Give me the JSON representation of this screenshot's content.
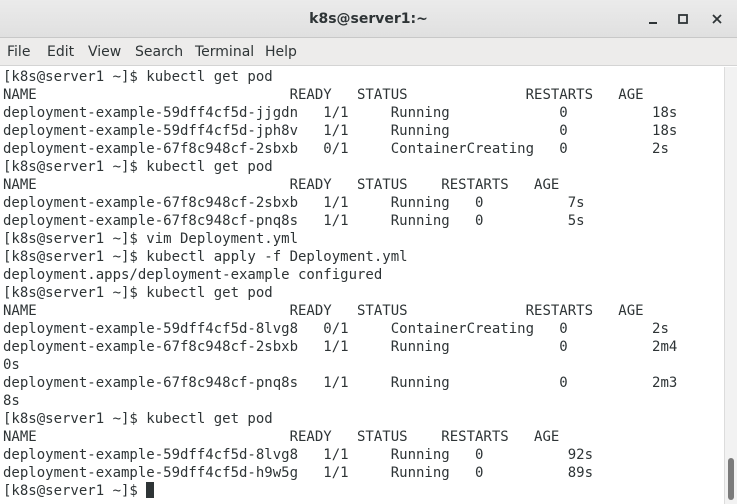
{
  "window": {
    "title": "k8s@server1:~"
  },
  "menubar": {
    "items": [
      "File",
      "Edit",
      "View",
      "Search",
      "Terminal",
      "Help"
    ]
  },
  "terminal": {
    "lines": [
      "[k8s@server1 ~]$ kubectl get pod",
      "NAME                              READY   STATUS              RESTARTS   AGE",
      "deployment-example-59dff4cf5d-jjgdn   1/1     Running             0          18s",
      "deployment-example-59dff4cf5d-jph8v   1/1     Running             0          18s",
      "deployment-example-67f8c948cf-2sbxb   0/1     ContainerCreating   0          2s",
      "[k8s@server1 ~]$ kubectl get pod",
      "NAME                              READY   STATUS    RESTARTS   AGE",
      "deployment-example-67f8c948cf-2sbxb   1/1     Running   0          7s",
      "deployment-example-67f8c948cf-pnq8s   1/1     Running   0          5s",
      "[k8s@server1 ~]$ vim Deployment.yml",
      "[k8s@server1 ~]$ kubectl apply -f Deployment.yml",
      "deployment.apps/deployment-example configured",
      "[k8s@server1 ~]$ kubectl get pod",
      "NAME                              READY   STATUS              RESTARTS   AGE",
      "deployment-example-59dff4cf5d-8lvg8   0/1     ContainerCreating   0          2s",
      "deployment-example-67f8c948cf-2sbxb   1/1     Running             0          2m4",
      "0s",
      "deployment-example-67f8c948cf-pnq8s   1/1     Running             0          2m3",
      "8s",
      "[k8s@server1 ~]$ kubectl get pod",
      "NAME                              READY   STATUS    RESTARTS   AGE",
      "deployment-example-59dff4cf5d-8lvg8   1/1     Running   0          92s",
      "deployment-example-59dff4cf5d-h9w5g   1/1     Running   0          89s"
    ],
    "prompt": "[k8s@server1 ~]$ "
  },
  "scrollbar": {
    "position_fraction": 0.9
  },
  "icons": {
    "minimize": "minimize-icon",
    "maximize": "maximize-icon",
    "close": "close-icon"
  }
}
